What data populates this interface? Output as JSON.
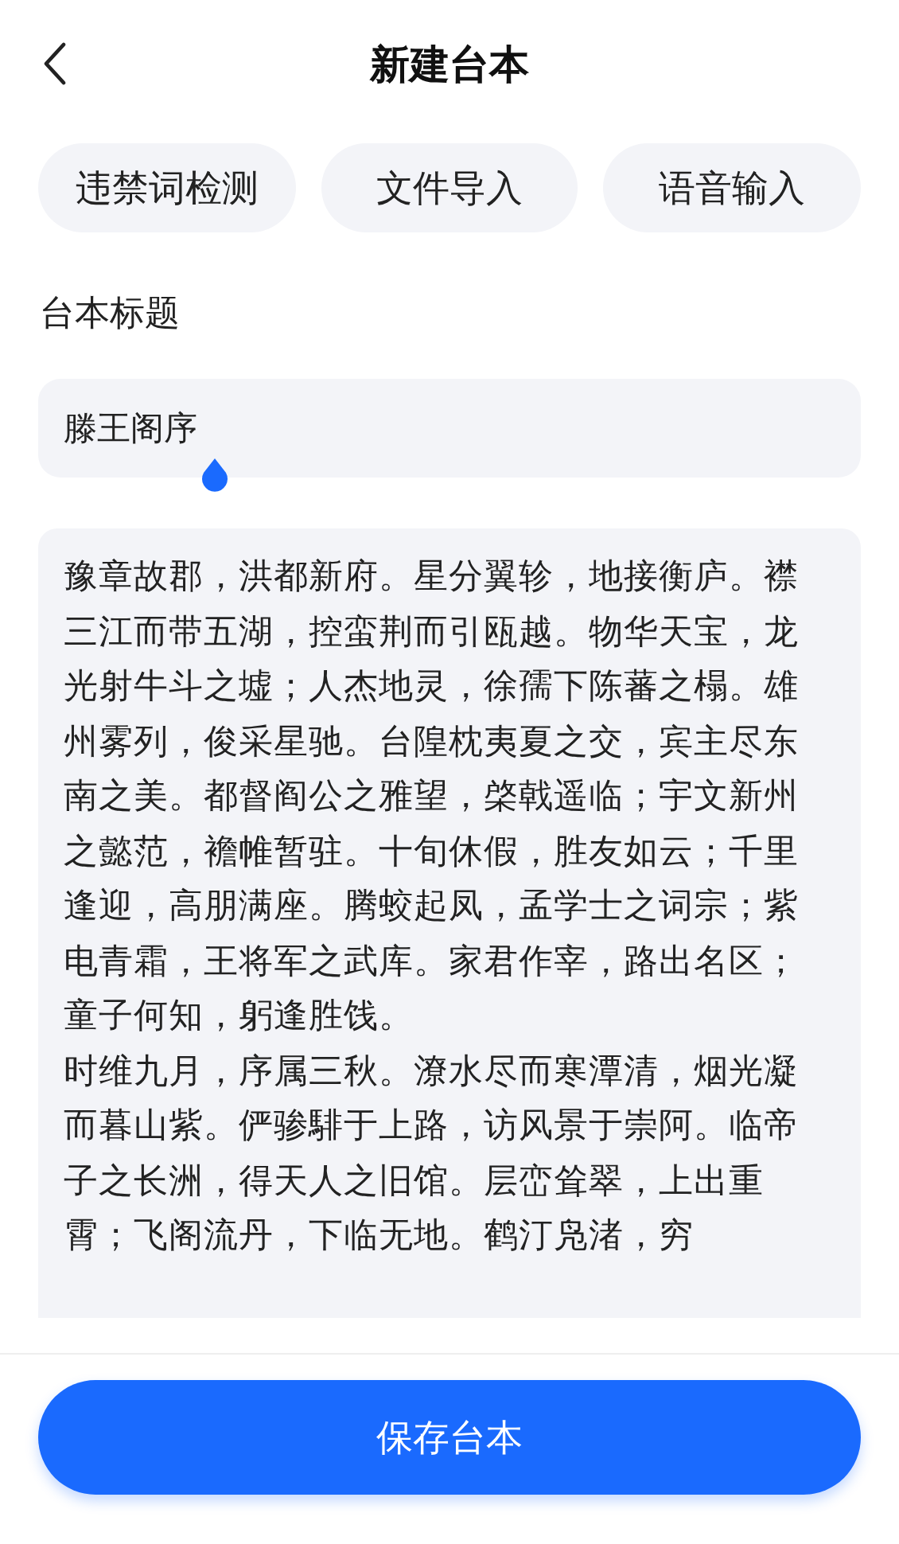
{
  "header": {
    "title": "新建台本"
  },
  "actions": [
    "违禁词检测",
    "文件导入",
    "语音输入"
  ],
  "title_field": {
    "label": "台本标题",
    "value": "滕王阁序"
  },
  "script_text": [
    "豫章故郡，洪都新府。星分翼轸，地接衡庐。襟三江而带五湖，控蛮荆而引瓯越。物华天宝，龙光射牛斗之墟；人杰地灵，徐孺下陈蕃之榻。雄州雾列，俊采星驰。台隍枕夷夏之交，宾主尽东南之美。都督阎公之雅望，棨戟遥临；宇文新州之懿范，襜帷暂驻。十旬休假，胜友如云；千里逢迎，高朋满座。腾蛟起凤，孟学士之词宗；紫电青霜，王将军之武库。家君作宰，路出名区；童子何知，躬逢胜饯。",
    "时维九月，序属三秋。潦水尽而寒潭清，烟光凝而暮山紫。俨骖騑于上路，访风景于崇阿。临帝子之长洲，得天人之旧馆。层峦耸翠，上出重霄；飞阁流丹，下临无地。鹤汀凫渚，穷"
  ],
  "save_button": "保存台本"
}
